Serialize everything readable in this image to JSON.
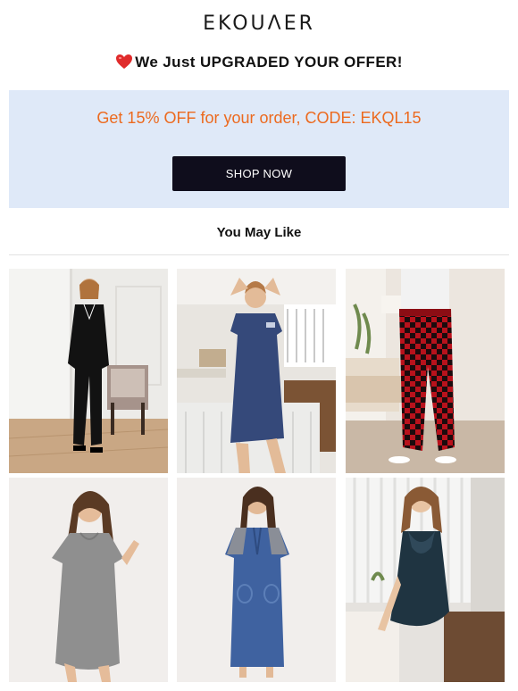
{
  "brand": {
    "logo_text": "EKOUΛER"
  },
  "headline": {
    "emoji": "heart-icon",
    "text": "We Just UPGRADED YOUR OFFER!"
  },
  "offer": {
    "text": "Get 15% OFF for your order, CODE: EKQL15",
    "text_color": "#ec6a1f",
    "background": "#dfe9f8",
    "button_label": "SHOP NOW",
    "button_color": "#0f0d1c"
  },
  "recommendations": {
    "title": "You May Like",
    "products": [
      {
        "name": "black-button-pajama-set"
      },
      {
        "name": "navy-short-sleeve-nightshirt"
      },
      {
        "name": "red-plaid-pajama-pants"
      },
      {
        "name": "gray-scoop-neck-nightgown"
      },
      {
        "name": "blue-henley-long-nightgown"
      },
      {
        "name": "navy-lace-chemise"
      }
    ]
  }
}
